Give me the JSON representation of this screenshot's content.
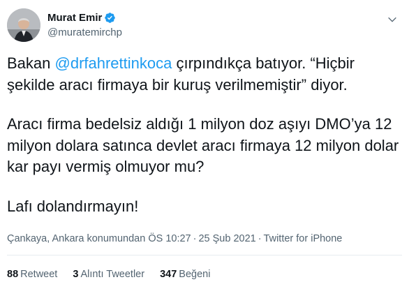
{
  "author": {
    "display_name": "Murat Emir",
    "handle": "@muratemirchp",
    "verified_icon": "verified-badge-icon"
  },
  "tweet": {
    "line1_prefix": "Bakan ",
    "mention": "@drfahrettinkoca",
    "line1_suffix": " çırpındıkça batıyor. “Hiçbir şekilde aracı firmaya bir kuruş verilmemiştir” diyor.",
    "paragraph2": "Aracı firma bedelsiz aldığı 1 milyon doz aşıyı DMO’ya 12 milyon dolara satınca devlet aracı firmaya 12 milyon dolar kar payı vermiş olmuyor mu?",
    "paragraph3": "Lafı dolandırmayın!"
  },
  "meta": {
    "location": "Çankaya, Ankara konumundan",
    "time": "ÖS 10:27",
    "date": "25 Şub 2021",
    "source": "Twitter for iPhone",
    "separator": "·"
  },
  "stats": {
    "retweets_count": "88",
    "retweets_label": "Retweet",
    "quotes_count": "3",
    "quotes_label": "Alıntı Tweetler",
    "likes_count": "347",
    "likes_label": "Beğeni"
  },
  "colors": {
    "link": "#1d9bf0",
    "text": "#0f1419",
    "secondary": "#536471"
  }
}
